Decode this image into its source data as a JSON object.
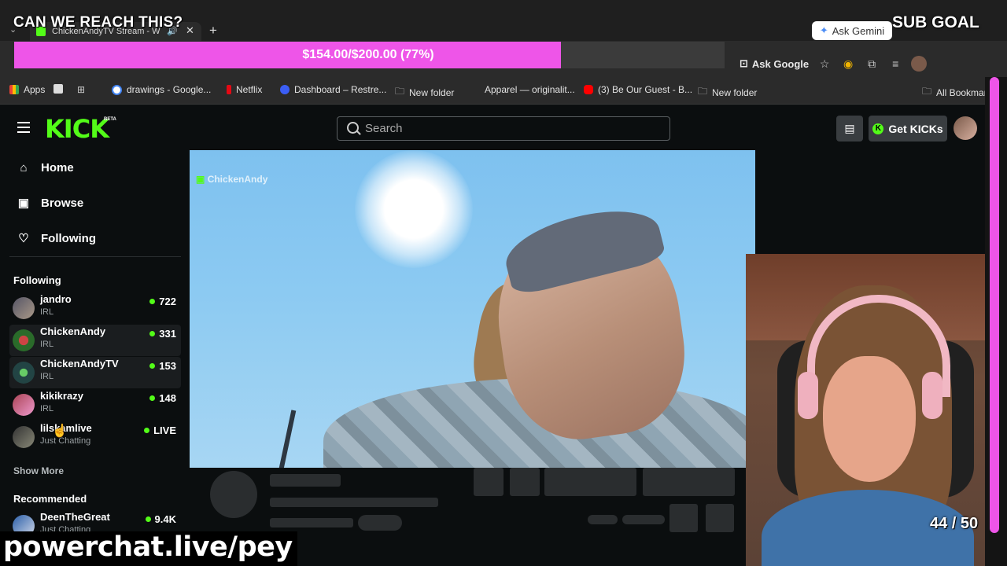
{
  "overlay": {
    "title": "CAN WE REACH THIS?",
    "sub_goal": "SUB GOAL",
    "goal_text": "$154.00/$200.00 (77%)",
    "goal_fraction": 0.77,
    "goal_color": "#ee55e8",
    "sub_counter": "44 / 50",
    "promo": "powerchat.live/pey"
  },
  "browser": {
    "tab_title": "ChickenAndyTV Stream - W",
    "ask_gemini": "Ask Gemini",
    "ask_google": "Ask Google",
    "bookmarks": [
      {
        "label": "Apps",
        "icon": "apps-grid-icon"
      },
      {
        "label": "drawings - Google...",
        "icon": "google-icon"
      },
      {
        "label": "Netflix",
        "icon": "netflix-icon"
      },
      {
        "label": "Dashboard – Restre...",
        "icon": "restream-icon"
      },
      {
        "label": "New folder",
        "icon": "folder-icon"
      },
      {
        "label": "Apparel — originalit...",
        "icon": "blank-icon"
      },
      {
        "label": "(3) Be Our Guest - B...",
        "icon": "youtube-icon"
      },
      {
        "label": "New folder",
        "icon": "folder-icon"
      },
      {
        "label": "All Bookmar",
        "icon": "folder-icon"
      }
    ]
  },
  "kick": {
    "logo": "KICK",
    "beta": "BETA",
    "search_placeholder": "Search",
    "get_kicks": "Get KICKs",
    "accent": "#53fc18",
    "nav": [
      {
        "label": "Home",
        "icon": "home-icon"
      },
      {
        "label": "Browse",
        "icon": "browse-icon"
      },
      {
        "label": "Following",
        "icon": "heart-icon"
      }
    ],
    "following_title": "Following",
    "following": [
      {
        "name": "jandro",
        "category": "IRL",
        "viewers": "722"
      },
      {
        "name": "ChickenAndy",
        "category": "IRL",
        "viewers": "331"
      },
      {
        "name": "ChickenAndyTV",
        "category": "IRL",
        "viewers": "153"
      },
      {
        "name": "kikikrazy",
        "category": "IRL",
        "viewers": "148"
      },
      {
        "name": "lilskamlive",
        "category": "Just Chatting",
        "viewers": "LIVE"
      }
    ],
    "show_more": "Show More",
    "recommended_title": "Recommended",
    "recommended": [
      {
        "name": "DeenTheGreat",
        "category": "Just Chatting",
        "viewers": "9.4K"
      }
    ],
    "player_watermark": "ChickenAndy"
  }
}
